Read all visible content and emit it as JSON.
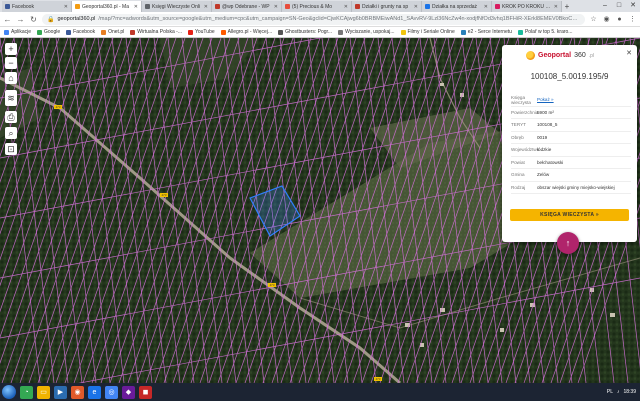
{
  "tabs": [
    {
      "label": "Facebook",
      "color": "#3b5998",
      "active": false
    },
    {
      "label": "Geoportal360.pl - Ma",
      "color": "#f39c12",
      "active": true
    },
    {
      "label": "Księgi Wieczyste Onli",
      "color": "#5f6368",
      "active": false
    },
    {
      "label": "@wp Odebrane - WP",
      "color": "#c0392b",
      "active": false
    },
    {
      "label": "(5) Precious & Mo",
      "color": "#e74c3c",
      "active": false
    },
    {
      "label": "Działki i grunty na sp",
      "color": "#c0392b",
      "active": false
    },
    {
      "label": "Działka na sprzedaż",
      "color": "#1a73e8",
      "active": false
    },
    {
      "label": "KROK PO KROKU Jak",
      "color": "#d81b60",
      "active": false
    }
  ],
  "address": {
    "host": "geoportal360.pl",
    "path": "/map/?mc=adwords&utm_source=google&utm_medium=cpc&utm_campaign=SN-Geo&gclid=CjwKCAjwg6b0BRBMEiwANd1_SAvvRV-9Lzl36NcZw4n-xodjfNfOd3vhq1BFHiR-XErkl8EMEV0BkoCxNM..."
  },
  "bookmarks": [
    {
      "label": "Aplikacje",
      "color": "#4285f4"
    },
    {
      "label": "Google",
      "color": "#34a853"
    },
    {
      "label": "Facebook",
      "color": "#3b5998"
    },
    {
      "label": "Onet.pl",
      "color": "#e67e22"
    },
    {
      "label": "Wirtualna Polska -...",
      "color": "#c0392b"
    },
    {
      "label": "YouTube",
      "color": "#e62117"
    },
    {
      "label": "Allegro.pl - Więcej...",
      "color": "#ff5a00"
    },
    {
      "label": "Ghostbusters: Pogr...",
      "color": "#555555"
    },
    {
      "label": "Wyciszanie, uspokaj...",
      "color": "#777777"
    },
    {
      "label": "Filmy i Seriale Online",
      "color": "#f1c40f"
    },
    {
      "label": "e2 - Serce Internetu",
      "color": "#2980b9"
    },
    {
      "label": "Polař w top 5. kraro...",
      "color": "#1abc9c"
    }
  ],
  "panel": {
    "logo_main": "Geoportal",
    "logo_num": "360",
    "logo_tld": ".pl",
    "parcel_id": "100108_5.0019.195/9",
    "rows": [
      {
        "key": "Księga wieczysta",
        "value": "Pokaż »",
        "link": true
      },
      {
        "key": "Powierzchnia",
        "value": "5900 m²",
        "link": false
      },
      {
        "key": "TERYT",
        "value": "100108_5",
        "link": false
      },
      {
        "key": "Obręb",
        "value": "0019",
        "link": false
      },
      {
        "key": "Województwo",
        "value": "łódzkie",
        "link": false
      },
      {
        "key": "Powiat",
        "value": "bełchatowski",
        "link": false
      },
      {
        "key": "Gmina",
        "value": "Zelów",
        "link": false
      },
      {
        "key": "Rodzaj",
        "value": "obszar wiejski gminy miejsko-wiejskiej",
        "link": false
      }
    ],
    "button": "KSIĘGA WIECZYSTA »"
  },
  "road_labels": [
    "473",
    "473",
    "473",
    "473"
  ],
  "taskbar": {
    "time": "18:39",
    "lang": "PL"
  }
}
